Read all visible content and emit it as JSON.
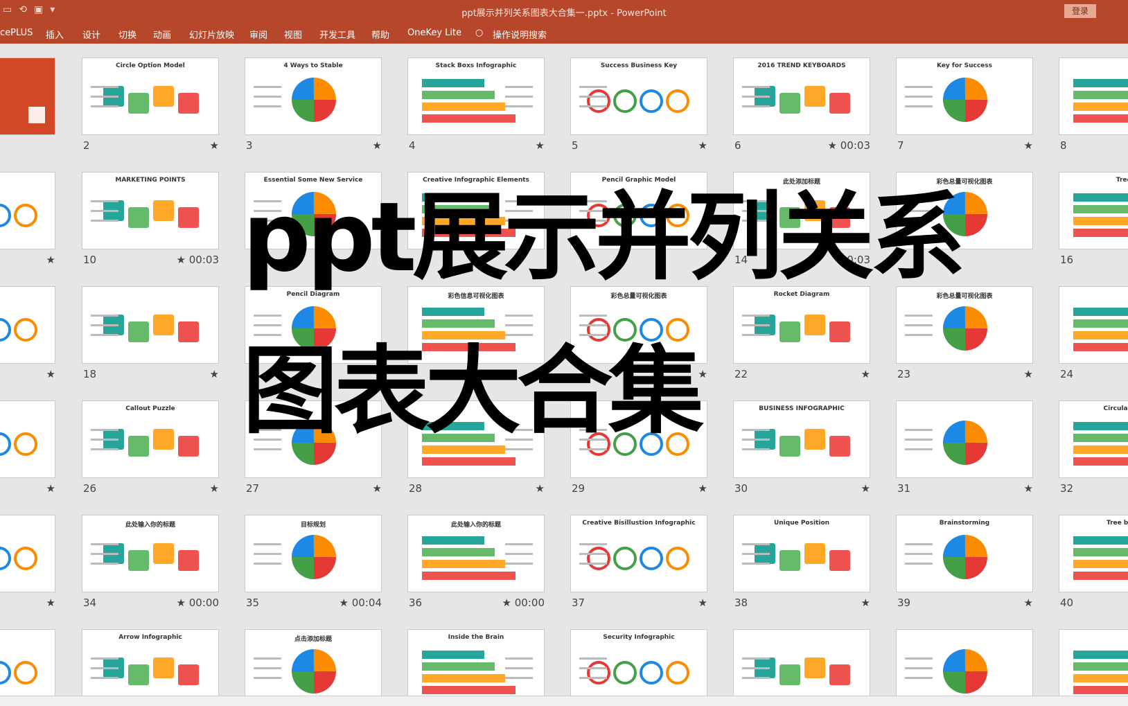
{
  "window": {
    "title": "ppt展示并列关系图表大合集一.pptx  -  PowerPoint",
    "login": "登录"
  },
  "ribbon": {
    "tabs": [
      "cePLUS",
      "插入",
      "设计",
      "切换",
      "动画",
      "幻灯片放映",
      "审阅",
      "视图",
      "开发工具",
      "帮助",
      "OneKey Lite"
    ],
    "search": "操作说明搜索"
  },
  "overlay": {
    "line1": "ppt展示并列关系",
    "line2": "图表大合集"
  },
  "slides": [
    {
      "num": "",
      "meta": "",
      "title": ""
    },
    {
      "num": "2",
      "meta": "★",
      "title": "Circle Option Model"
    },
    {
      "num": "3",
      "meta": "★",
      "title": "4 Ways to Stable"
    },
    {
      "num": "4",
      "meta": "★",
      "title": "Stack Boxs Infographic"
    },
    {
      "num": "5",
      "meta": "★",
      "title": "Success Business Key"
    },
    {
      "num": "6",
      "meta": "★ 00:03",
      "title": "2016 TREND KEYBOARDS"
    },
    {
      "num": "7",
      "meta": "★",
      "title": "Key for Success"
    },
    {
      "num": "8",
      "meta": "",
      "title": ""
    },
    {
      "num": "",
      "meta": "★",
      "title": ""
    },
    {
      "num": "10",
      "meta": "★ 00:03",
      "title": "MARKETING POINTS"
    },
    {
      "num": "",
      "meta": "",
      "title": "Essential Some New Service"
    },
    {
      "num": "",
      "meta": "",
      "title": "Creative Infographic Elements"
    },
    {
      "num": "",
      "meta": "",
      "title": "Pencil Graphic Model"
    },
    {
      "num": "14",
      "meta": "00:03",
      "title": "此处添加标题"
    },
    {
      "num": "",
      "meta": "",
      "title": "彩色总量可视化图表"
    },
    {
      "num": "16",
      "meta": "",
      "title": "Tree D"
    },
    {
      "num": "",
      "meta": "★",
      "title": ""
    },
    {
      "num": "18",
      "meta": "★",
      "title": ""
    },
    {
      "num": "",
      "meta": "",
      "title": "Pencil Diagram"
    },
    {
      "num": "",
      "meta": "",
      "title": "彩色信息可视化图表"
    },
    {
      "num": "",
      "meta": "★",
      "title": "彩色总量可视化图表"
    },
    {
      "num": "22",
      "meta": "★",
      "title": "Rocket Diagram"
    },
    {
      "num": "23",
      "meta": "★",
      "title": "彩色总量可视化图表"
    },
    {
      "num": "24",
      "meta": "",
      "title": ""
    },
    {
      "num": "",
      "meta": "★",
      "title": ""
    },
    {
      "num": "26",
      "meta": "★",
      "title": "Callout Puzzle"
    },
    {
      "num": "27",
      "meta": "★",
      "title": ""
    },
    {
      "num": "28",
      "meta": "★",
      "title": ""
    },
    {
      "num": "29",
      "meta": "★",
      "title": ""
    },
    {
      "num": "30",
      "meta": "★",
      "title": "BUSINESS INFOGRAPHIC"
    },
    {
      "num": "31",
      "meta": "★",
      "title": ""
    },
    {
      "num": "32",
      "meta": "",
      "title": "Circular Infog"
    },
    {
      "num": "",
      "meta": "★",
      "title": ""
    },
    {
      "num": "34",
      "meta": "★ 00:00",
      "title": "此处输入你的标题"
    },
    {
      "num": "35",
      "meta": "★ 00:04",
      "title": "目标规划"
    },
    {
      "num": "36",
      "meta": "★ 00:00",
      "title": "此处输入你的标题"
    },
    {
      "num": "37",
      "meta": "★",
      "title": "Creative Bisillustion Infographic"
    },
    {
      "num": "38",
      "meta": "★",
      "title": "Unique Position"
    },
    {
      "num": "39",
      "meta": "★",
      "title": "Brainstorming"
    },
    {
      "num": "40",
      "meta": "",
      "title": "Tree branch"
    },
    {
      "num": "",
      "meta": "",
      "title": ""
    },
    {
      "num": "",
      "meta": "",
      "title": "Arrow Infographic"
    },
    {
      "num": "",
      "meta": "",
      "title": "点击添加标题"
    },
    {
      "num": "",
      "meta": "",
      "title": "Inside the Brain"
    },
    {
      "num": "",
      "meta": "",
      "title": "Security Infographic"
    },
    {
      "num": "",
      "meta": "",
      "title": ""
    },
    {
      "num": "",
      "meta": "",
      "title": ""
    },
    {
      "num": "",
      "meta": "",
      "title": ""
    }
  ],
  "colors": {
    "ribbon": "#b7472a",
    "accent_red": "#d24726",
    "green": "#8bc34a",
    "blue": "#2196f3",
    "orange": "#ff9800",
    "purple": "#9c27b0"
  }
}
